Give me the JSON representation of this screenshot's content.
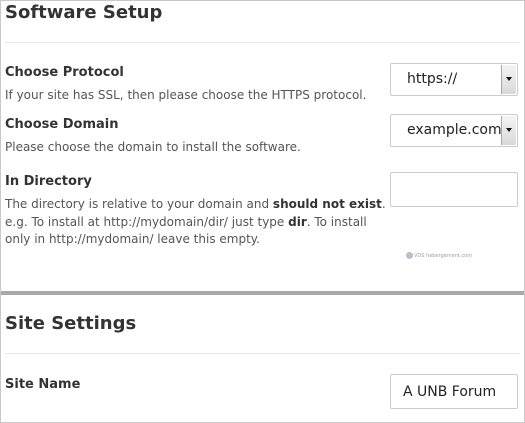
{
  "software_setup": {
    "title": "Software Setup",
    "protocol": {
      "label": "Choose Protocol",
      "help": "If your site has SSL, then please choose the HTTPS protocol.",
      "value": "https://"
    },
    "domain": {
      "label": "Choose Domain",
      "help": "Please choose the domain to install the software.",
      "value": "example.com"
    },
    "directory": {
      "label": "In Directory",
      "help_1": "The directory is relative to your domain and ",
      "help_bold_1": "should not exist",
      "help_2": ". e.g. To install at http://mydomain/dir/ just type ",
      "help_bold_2": "dir",
      "help_3": ". To install only in http://mydomain/ leave this empty.",
      "value": ""
    },
    "watermark": "VDS hebergement.com"
  },
  "site_settings": {
    "title": "Site Settings",
    "site_name": {
      "label": "Site Name",
      "value": "A UNB Forum"
    }
  },
  "colors": {
    "border": "#c9c9c9",
    "separator": "#a9a9a9",
    "text": "#333333"
  }
}
